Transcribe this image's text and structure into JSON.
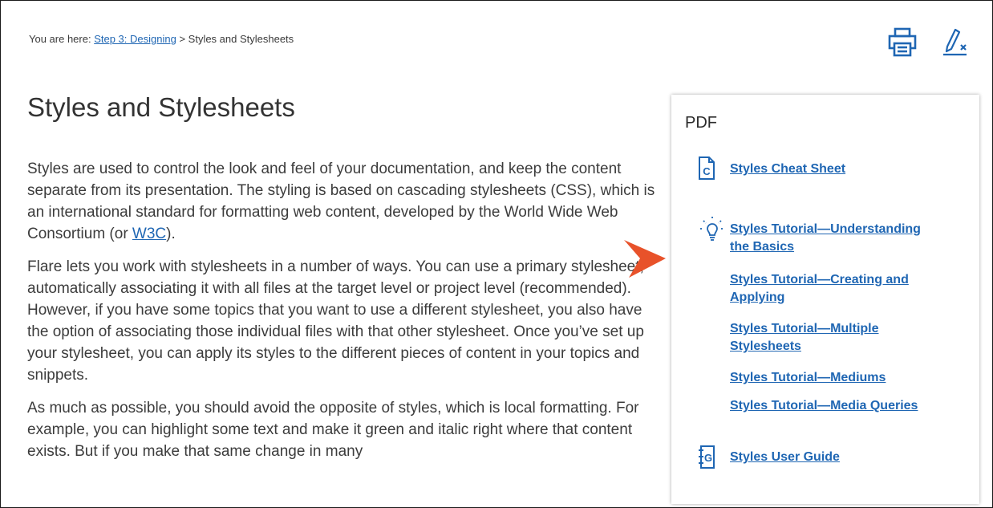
{
  "breadcrumb": {
    "prefix": "You are here: ",
    "link": "Step 3: Designing",
    "separator": " > ",
    "current": "Styles and Stylesheets"
  },
  "toolbar": {
    "print_icon": "printer-icon",
    "clear_icon": "pen-clear-highlight-icon"
  },
  "page": {
    "title": "Styles and Stylesheets",
    "para1_text": "Styles are used to control the look and feel of your documentation, and keep the content separate from its presentation. The styling is based on cascading stylesheets (CSS), which is an international standard for formatting web content, developed by the World Wide Web Consortium (or ",
    "para1_link": "W3C",
    "para1_end": ").",
    "para2": "Flare lets you work with stylesheets in a number of ways. You can use a primary stylesheet, automatically associating it with all files at the target level or project level (recommended). However, if you have some topics that you want to use a different stylesheet, you also have the option of associating those individual files with that other stylesheet. Once you’ve set up your stylesheet, you can apply its styles to the different pieces of content in your topics and snippets.",
    "para3": "As much as possible, you should avoid the opposite of styles, which is local formatting. For example, you can highlight some text and make it green and italic right where that content exists. But if you make that same change in many"
  },
  "pdf_panel": {
    "heading": "PDF",
    "cheat_sheet": {
      "icon": "cheat-sheet-c-icon",
      "icon_letter": "C",
      "label": "Styles Cheat Sheet"
    },
    "tutorials_icon": "lightbulb-icon",
    "tutorials": [
      {
        "line1": "Styles Tutorial—Understanding",
        "line2": "the Basics"
      },
      {
        "line1": "Styles Tutorial—Creating and",
        "line2": "Applying"
      },
      {
        "line1": "Styles Tutorial—Multiple",
        "line2": "Stylesheets"
      },
      {
        "line1": "Styles Tutorial—Mediums",
        "line2": ""
      },
      {
        "line1": "Styles Tutorial—Media Queries",
        "line2": ""
      }
    ],
    "user_guide": {
      "icon": "user-guide-g-icon",
      "icon_letter": "G",
      "label": "Styles User Guide"
    }
  },
  "colors": {
    "link": "#1f66b3",
    "arrow": "#e8522a",
    "text": "#3c3c3c"
  }
}
